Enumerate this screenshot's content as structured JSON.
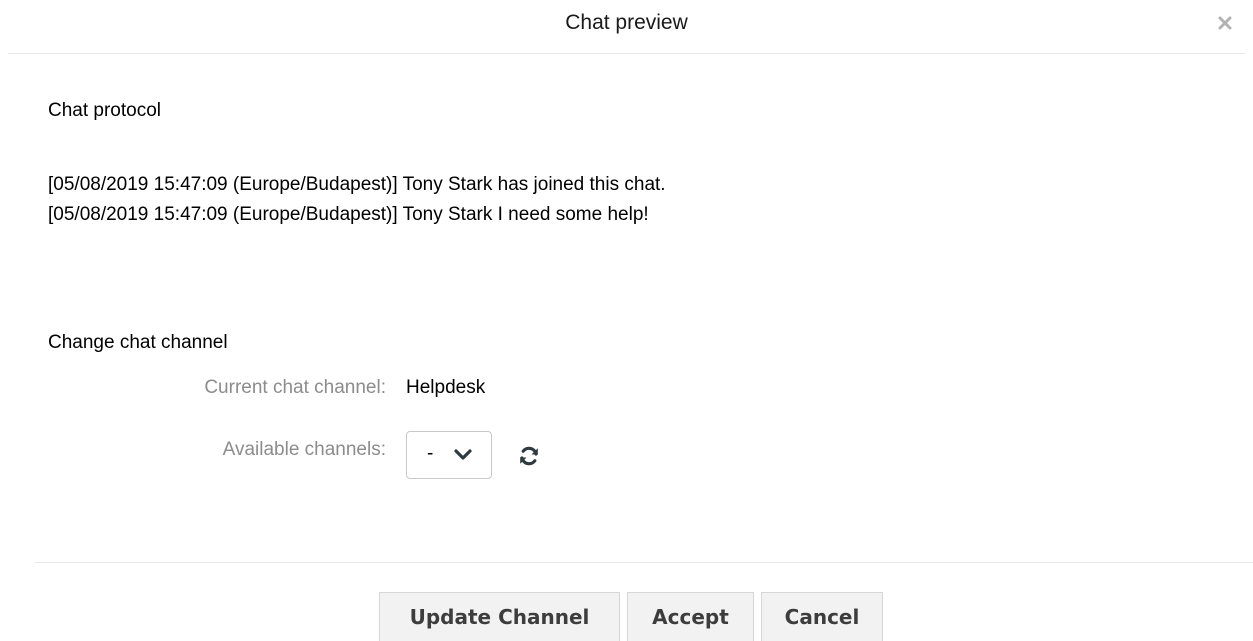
{
  "header": {
    "title": "Chat preview",
    "close_icon": "close-icon"
  },
  "protocol": {
    "title": "Chat protocol",
    "lines": [
      "[05/08/2019 15:47:09 (Europe/Budapest)] Tony Stark has joined this chat.",
      "[05/08/2019 15:47:09 (Europe/Budapest)] Tony Stark I need some help!"
    ]
  },
  "channel": {
    "title": "Change chat channel",
    "current_label": "Current chat channel:",
    "current_value": "Helpdesk",
    "available_label": "Available channels:",
    "available_selected": "-",
    "refresh_icon": "refresh-icon"
  },
  "footer": {
    "update_label": "Update Channel",
    "accept_label": "Accept",
    "cancel_label": "Cancel"
  },
  "colors": {
    "label_gray": "#8c8c8c",
    "button_bg": "#f2f2f2",
    "icon_dark": "#2f3a40"
  }
}
